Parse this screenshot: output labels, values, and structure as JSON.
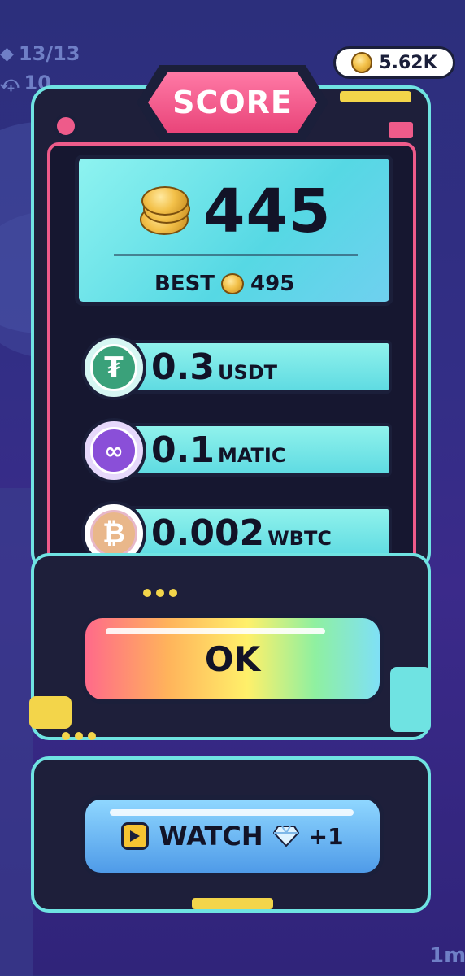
{
  "hud": {
    "fish_count": "13/13",
    "hook_count": "10",
    "coins": "5.62K"
  },
  "score_card": {
    "title": "SCORE",
    "score": "445",
    "best_label": "BEST",
    "best_value": "495"
  },
  "rewards": [
    {
      "amount": "0.3",
      "unit": "USDT",
      "icon": "tether-icon",
      "color": "#3aa17a"
    },
    {
      "amount": "0.1",
      "unit": "MATIC",
      "icon": "polygon-icon",
      "color": "#8a4fd8"
    },
    {
      "amount": "0.002",
      "unit": "WBTC",
      "icon": "bitcoin-icon",
      "color": "#e7b7c8"
    }
  ],
  "buttons": {
    "ok_label": "OK",
    "watch_label": "WATCH",
    "watch_bonus": "+1"
  },
  "footer": {
    "distance": "1m"
  },
  "colors": {
    "frame_cyan": "#6fe3e2",
    "frame_pink": "#ee5b8a",
    "accent_yellow": "#f3d54a",
    "dark": "#1b1f3a"
  }
}
